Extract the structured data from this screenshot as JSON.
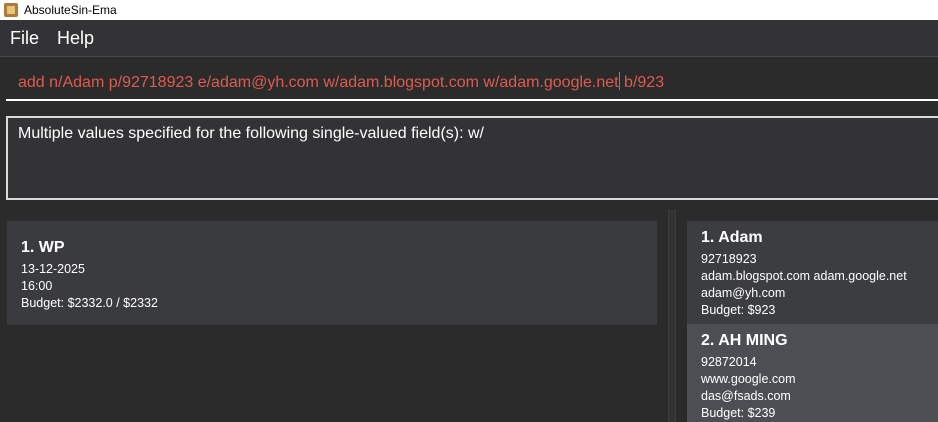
{
  "window": {
    "title": "AbsoluteSin-Ema"
  },
  "menu": {
    "file": "File",
    "help": "Help"
  },
  "command": {
    "text_before_caret": "add n/Adam p/92718923 e/adam@yh.com w/adam.blogspot.com w/adam.google.net",
    "text_after_caret": " b/923"
  },
  "result": {
    "message": "Multiple values specified for the following single-valued field(s): w/"
  },
  "events": [
    {
      "title": "1. WP",
      "date": "13-12-2025",
      "time": "16:00",
      "budget": "Budget: $2332.0 / $2332"
    }
  ],
  "contacts": [
    {
      "title": "1. Adam",
      "phone": "92718923",
      "websites": "adam.blogspot.com adam.google.net",
      "email": "adam@yh.com",
      "budget": "Budget: $923"
    },
    {
      "title": "2. AH MING",
      "phone": "92872014",
      "websites": "www.google.com",
      "email": "das@fsads.com",
      "budget": "Budget: $239"
    }
  ],
  "colors": {
    "background": "#2b2b2b",
    "command_text": "#e05a4e",
    "card": "#3a3b3e",
    "card_selected": "#4b4f53"
  },
  "icons": {
    "app": "app-icon"
  }
}
